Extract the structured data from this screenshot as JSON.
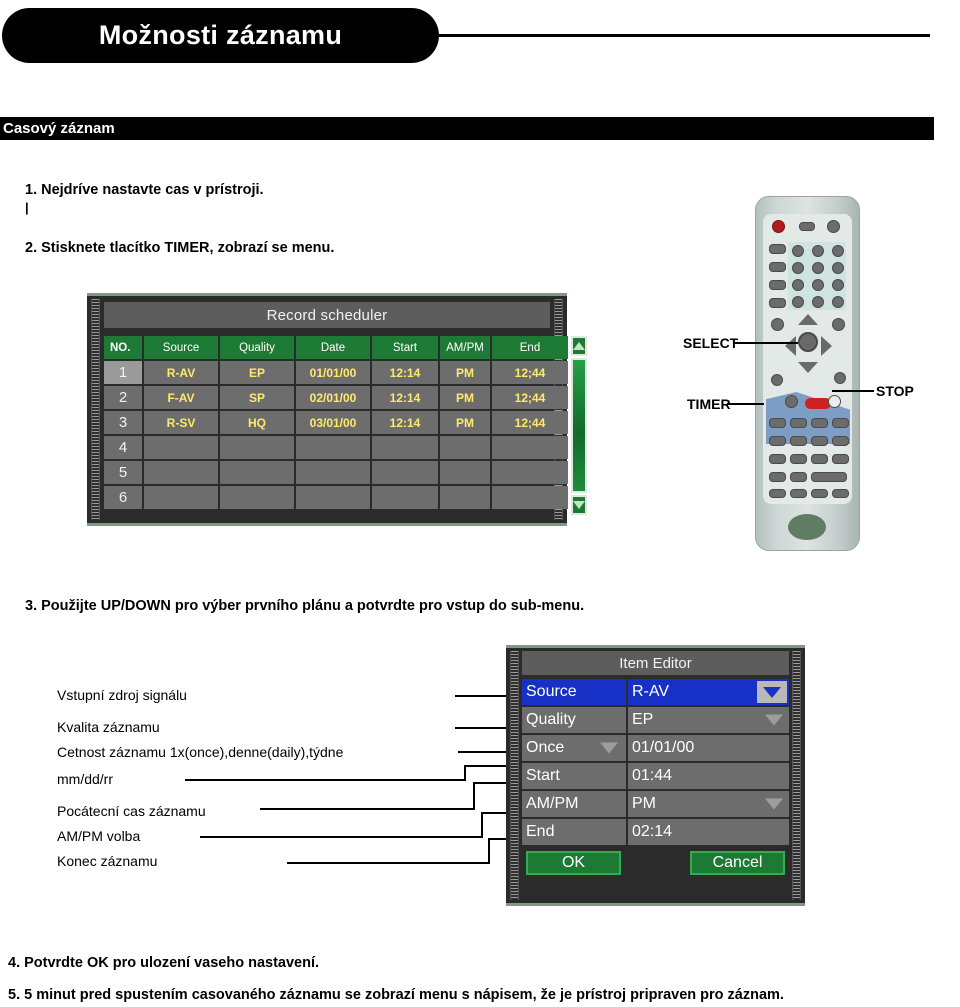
{
  "header": {
    "title": "Možnosti záznamu",
    "section": "Casový záznam"
  },
  "steps": {
    "s1": "1. Nejdríve nastavte cas v prístroji.",
    "s1_cursor": "|",
    "s2": "2. Stisknete tlacítko TIMER, zobrazí se menu.",
    "s3": "3. Použijte  UP/DOWN pro výber prvního plánu a potvrdte pro vstup do sub-menu.",
    "s4": "4. Potvrdte OK pro ulození vaseho nastavení.",
    "s5": "5. 5 minut pred spustením casovaného záznamu se zobrazí menu s nápisem, že je prístroj pripraven pro záznam."
  },
  "scheduler": {
    "title": "Record scheduler",
    "columns": [
      "NO.",
      "Source",
      "Quality",
      "Date",
      "Start",
      "AM/PM",
      "End"
    ],
    "rows": [
      {
        "no": "1",
        "source": "R-AV",
        "quality": "EP",
        "date": "01/01/00",
        "start": "12:14",
        "ampm": "PM",
        "end": "12;44"
      },
      {
        "no": "2",
        "source": "F-AV",
        "quality": "SP",
        "date": "02/01/00",
        "start": "12:14",
        "ampm": "PM",
        "end": "12;44"
      },
      {
        "no": "3",
        "source": "R-SV",
        "quality": "HQ",
        "date": "03/01/00",
        "start": "12:14",
        "ampm": "PM",
        "end": "12;44"
      },
      {
        "no": "4",
        "source": "",
        "quality": "",
        "date": "",
        "start": "",
        "ampm": "",
        "end": ""
      },
      {
        "no": "5",
        "source": "",
        "quality": "",
        "date": "",
        "start": "",
        "ampm": "",
        "end": ""
      },
      {
        "no": "6",
        "source": "",
        "quality": "",
        "date": "",
        "start": "",
        "ampm": "",
        "end": ""
      }
    ],
    "scroll_up_icon": "triangle-up-icon",
    "scroll_down_icon": "triangle-down-icon",
    "colors": {
      "header_green": "#1d7a34",
      "cell_gray": "#6d6d6d",
      "value_yellow": "#ffe96b"
    }
  },
  "item_editor": {
    "title": "Item Editor",
    "rows": [
      {
        "label": "Source",
        "value": "R-AV",
        "selected": true,
        "label_caret": false,
        "value_caret": true
      },
      {
        "label": "Quality",
        "value": "EP",
        "selected": false,
        "label_caret": false,
        "value_caret": true
      },
      {
        "label": "Once",
        "value": "01/01/00",
        "selected": false,
        "label_caret": true,
        "value_caret": false
      },
      {
        "label": "Start",
        "value": "01:44",
        "selected": false,
        "label_caret": false,
        "value_caret": false
      },
      {
        "label": "AM/PM",
        "value": "PM",
        "selected": false,
        "label_caret": false,
        "value_caret": true
      },
      {
        "label": "End",
        "value": "02:14",
        "selected": false,
        "label_caret": false,
        "value_caret": false
      }
    ],
    "ok_label": "OK",
    "cancel_label": "Cancel",
    "colors": {
      "selected_blue": "#1731c6",
      "button_green": "#1d7a34"
    }
  },
  "callouts": [
    "Vstupní zdroj signálu",
    "Kvalita záznamu",
    "Cetnost záznamu 1x(once),denne(daily),týdne",
    "mm/dd/rr",
    "Pocátecní cas záznamu",
    "AM/PM volba",
    "Konec záznamu"
  ],
  "remote": {
    "labels": {
      "select": "SELECT",
      "timer": "TIMER",
      "stop": "STOP"
    }
  }
}
